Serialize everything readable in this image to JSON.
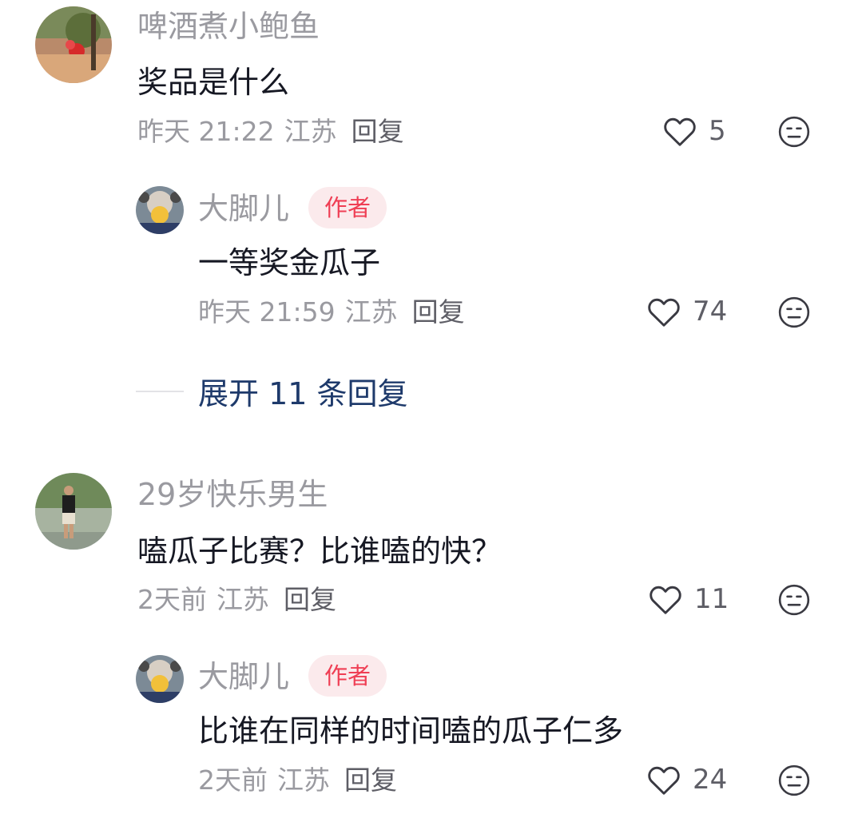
{
  "comments": [
    {
      "username": "啤酒煮小鲍鱼",
      "content": "奖品是什么",
      "time": "昨天 21:22",
      "location": "江苏",
      "reply_label": "回复",
      "likes": "5"
    },
    {
      "username": "大脚儿",
      "badge": "作者",
      "content": "一等奖金瓜子",
      "time": "昨天 21:59",
      "location": "江苏",
      "reply_label": "回复",
      "likes": "74"
    },
    {
      "username": "29岁快乐男生",
      "content": "嗑瓜子比赛？比谁嗑的快？",
      "time": "2天前",
      "location": "江苏",
      "reply_label": "回复",
      "likes": "11"
    },
    {
      "username": "大脚儿",
      "badge": "作者",
      "content": "比谁在同样的时间嗑的瓜子仁多",
      "time": "2天前",
      "location": "江苏",
      "reply_label": "回复",
      "likes": "24"
    }
  ],
  "expand_replies": "展开 11 条回复",
  "icons": {
    "like": "heart-outline-icon",
    "dislike": "meh-face-icon"
  },
  "colors": {
    "username": "#9a9aa0",
    "content": "#161823",
    "badge_bg": "#fbeaec",
    "badge_text": "#ef3e54",
    "expand_link": "#1e3a6b"
  }
}
